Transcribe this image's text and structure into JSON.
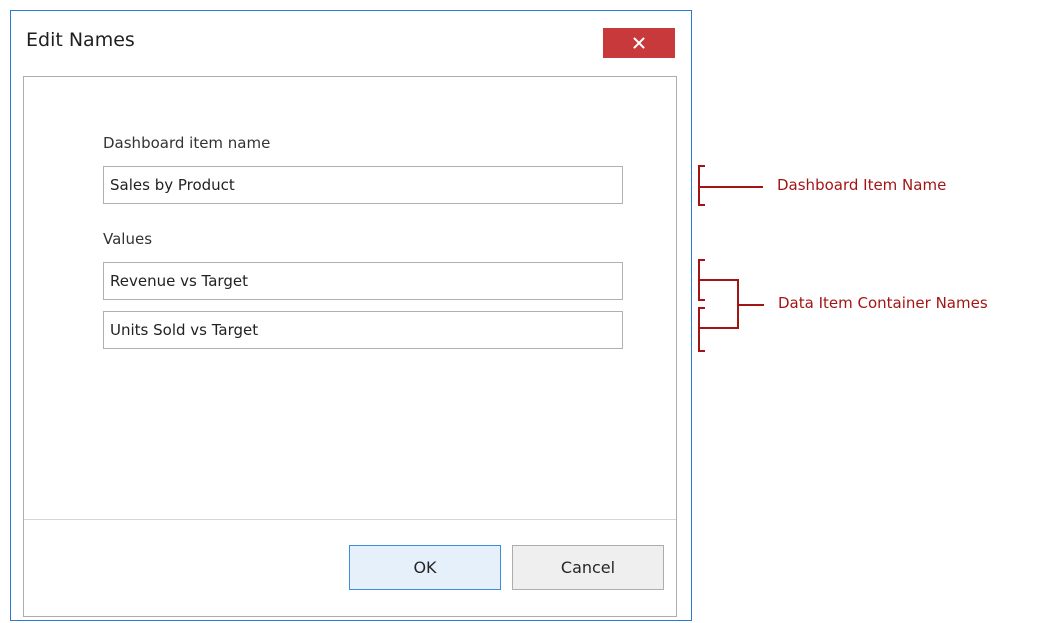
{
  "dialog": {
    "title": "Edit Names",
    "close_glyph": "×",
    "dashboard_item_label": "Dashboard item name",
    "dashboard_item_value": "Sales by Product",
    "values_label": "Values",
    "values": [
      "Revenue vs Target",
      "Units Sold vs Target"
    ],
    "ok_label": "OK",
    "cancel_label": "Cancel"
  },
  "annotations": {
    "dashboard_item_name": "Dashboard Item Name",
    "data_item_container_names": "Data Item Container Names"
  },
  "colors": {
    "close_button": "#c7393a",
    "annotation": "#a31515",
    "accent_border": "#3c8de0"
  }
}
